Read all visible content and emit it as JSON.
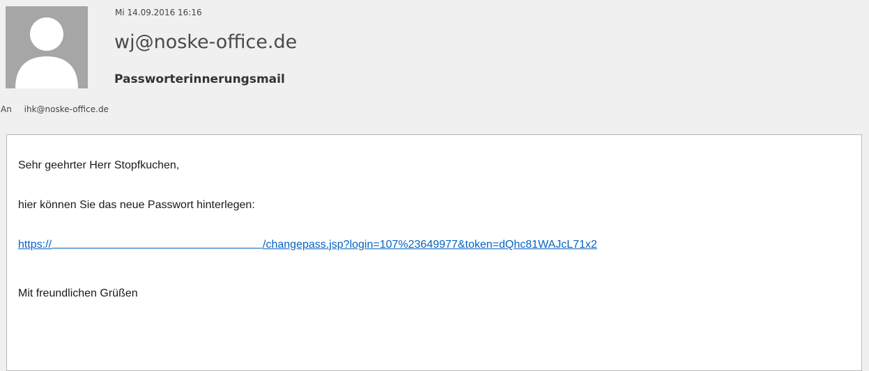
{
  "header": {
    "date": "Mi 14.09.2016 16:16",
    "sender": "wj@noske-office.de",
    "subject": "Passworterinnerungsmail",
    "to_label": "An",
    "to_address": "ihk@noske-office.de"
  },
  "body": {
    "greeting": "Sehr geehrter Herr Stopfkuchen,",
    "intro": "hier können Sie das neue Passwort hinterlegen:",
    "link_prefix": "https://",
    "link_suffix": "/changepass.jsp?login=107%23649977&token=dQhc81WAJcL71x2",
    "closing": "Mit freundlichen Grüßen"
  },
  "icons": {
    "avatar": "person-silhouette-icon"
  },
  "colors": {
    "background": "#f0f0f0",
    "link": "#0563c1",
    "avatar_bg": "#a6a6a6"
  }
}
